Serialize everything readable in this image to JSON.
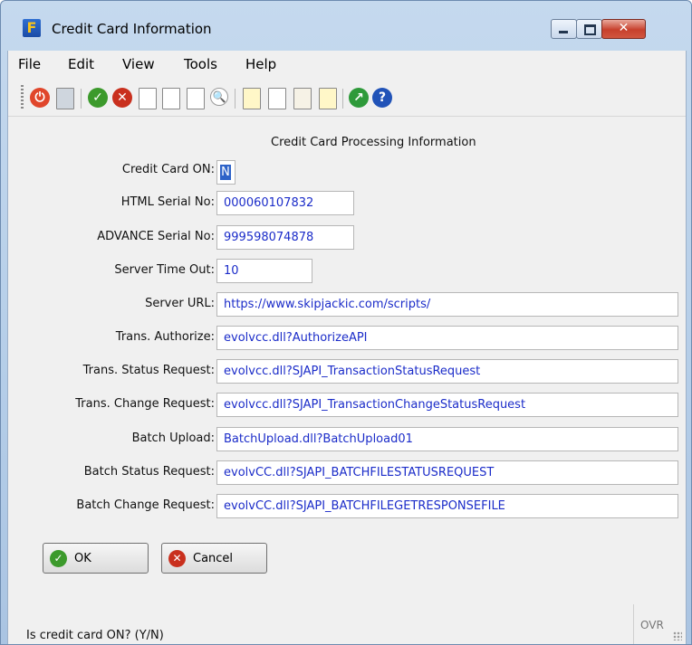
{
  "window": {
    "title": "Credit Card Information",
    "close_glyph": "✕"
  },
  "menu": [
    "File",
    "Edit",
    "View",
    "Tools",
    "Help"
  ],
  "toolbar": {
    "icons": [
      "power-icon",
      "printer-icon",
      "ok-check-icon",
      "cancel-x-icon",
      "copy-page-icon",
      "paste-page-icon",
      "select-page-icon",
      "zoom-icon",
      "notepad-icon",
      "clipboard-icon",
      "pencil-doc-icon",
      "checked-notepad-icon",
      "chart-icon",
      "help-icon"
    ]
  },
  "form": {
    "section_title": "Credit Card Processing Information",
    "credit_card_on": {
      "label": "Credit Card ON:",
      "value": "N"
    },
    "html_serial": {
      "label": "HTML Serial No:",
      "value": "000060107832"
    },
    "advance_serial": {
      "label": "ADVANCE Serial No:",
      "value": "999598074878"
    },
    "server_timeout": {
      "label": "Server Time Out:",
      "value": "10"
    },
    "server_url": {
      "label": "Server URL:",
      "value": "https://www.skipjackic.com/scripts/"
    },
    "trans_authorize": {
      "label": "Trans. Authorize:",
      "value": "evolvcc.dll?AuthorizeAPI"
    },
    "trans_status": {
      "label": "Trans. Status Request:",
      "value": "evolvcc.dll?SJAPI_TransactionStatusRequest"
    },
    "trans_change": {
      "label": "Trans. Change Request:",
      "value": "evolvcc.dll?SJAPI_TransactionChangeStatusRequest"
    },
    "batch_upload": {
      "label": "Batch Upload:",
      "value": "BatchUpload.dll?BatchUpload01"
    },
    "batch_status": {
      "label": "Batch Status Request:",
      "value": "evolvCC.dll?SJAPI_BATCHFILESTATUSREQUEST"
    },
    "batch_change": {
      "label": "Batch Change Request:",
      "value": "evolvCC.dll?SJAPI_BATCHFILEGETRESPONSEFILE"
    }
  },
  "buttons": {
    "ok": "OK",
    "cancel": "Cancel"
  },
  "status": {
    "message": "Is credit card ON? (Y/N)",
    "mode": "OVR"
  },
  "colors": {
    "field_text": "#1b2cc9",
    "ok_green": "#3c9a2c",
    "cancel_red": "#c9301e",
    "title_bar": "#b4cde8"
  }
}
